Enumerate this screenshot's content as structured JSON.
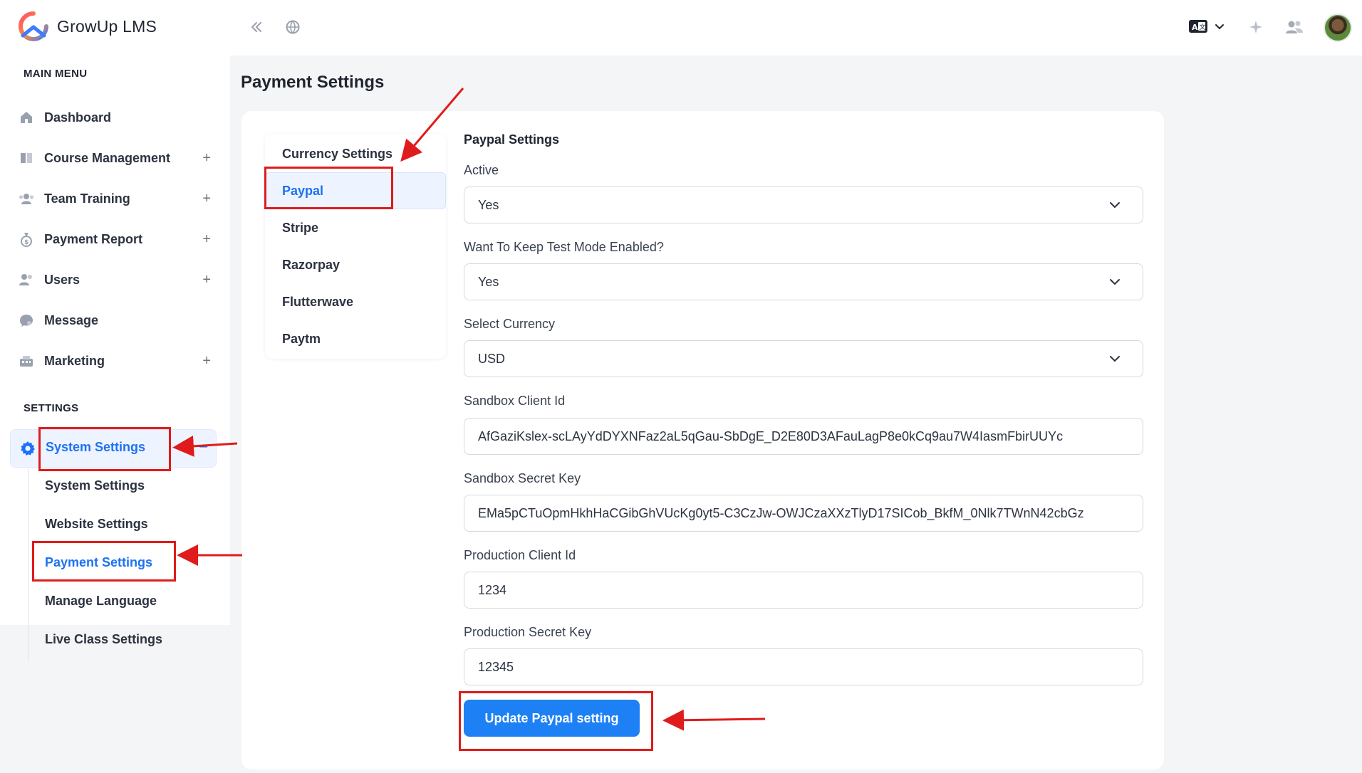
{
  "header": {
    "app_name": "GrowUp LMS",
    "icons": [
      "collapse-sidebar-icon",
      "globe-icon",
      "language-icon",
      "chevron-down-icon",
      "sparkle-icon",
      "users-icon",
      "avatar"
    ]
  },
  "sidebar": {
    "main_menu_label": "MAIN MENU",
    "items": [
      {
        "label": "Dashboard",
        "icon": "home-icon",
        "expandable": false
      },
      {
        "label": "Course Management",
        "icon": "book-icon",
        "expandable": true
      },
      {
        "label": "Team Training",
        "icon": "team-icon",
        "expandable": true
      },
      {
        "label": "Payment Report",
        "icon": "money-bag-icon",
        "expandable": true
      },
      {
        "label": "Users",
        "icon": "users-icon",
        "expandable": true
      },
      {
        "label": "Message",
        "icon": "message-icon",
        "expandable": false
      },
      {
        "label": "Marketing",
        "icon": "marketing-icon",
        "expandable": true
      }
    ],
    "settings_label": "SETTINGS",
    "active_group": {
      "label": "System Settings",
      "icon": "gear-icon",
      "toggle": "–"
    },
    "plus_symbol": "+",
    "submenu": [
      {
        "label": "System Settings",
        "active": false
      },
      {
        "label": "Website Settings",
        "active": false
      },
      {
        "label": "Payment Settings",
        "active": true
      },
      {
        "label": "Manage Language",
        "active": false
      },
      {
        "label": "Live Class Settings",
        "active": false
      }
    ]
  },
  "main": {
    "page_title": "Payment Settings",
    "tabs": [
      {
        "label": "Currency Settings",
        "active": false
      },
      {
        "label": "Paypal",
        "active": true
      },
      {
        "label": "Stripe",
        "active": false
      },
      {
        "label": "Razorpay",
        "active": false
      },
      {
        "label": "Flutterwave",
        "active": false
      },
      {
        "label": "Paytm",
        "active": false
      }
    ],
    "form": {
      "title": "Paypal Settings",
      "fields": [
        {
          "label": "Active",
          "value": "Yes",
          "type": "select"
        },
        {
          "label": "Want To Keep Test Mode Enabled?",
          "value": "Yes",
          "type": "select"
        },
        {
          "label": "Select Currency",
          "value": "USD",
          "type": "select"
        },
        {
          "label": "Sandbox Client Id",
          "value": "AfGaziKslex-scLAyYdDYXNFaz2aL5qGau-SbDgE_D2E80D3AFauLagP8e0kCq9au7W4IasmFbirUUYc",
          "type": "text"
        },
        {
          "label": "Sandbox Secret Key",
          "value": "EMa5pCTuOpmHkhHaCGibGhVUcKg0yt5-C3CzJw-OWJCzaXXzTlyD17SICob_BkfM_0Nlk7TWnN42cbGz",
          "type": "text"
        },
        {
          "label": "Production Client Id",
          "value": "1234",
          "type": "text"
        },
        {
          "label": "Production Secret Key",
          "value": "12345",
          "type": "text"
        }
      ],
      "submit_label": "Update Paypal setting"
    }
  },
  "colors": {
    "accent": "#1d80f5",
    "annotation": "#e01b1b",
    "active_bg": "#eef4ff"
  }
}
